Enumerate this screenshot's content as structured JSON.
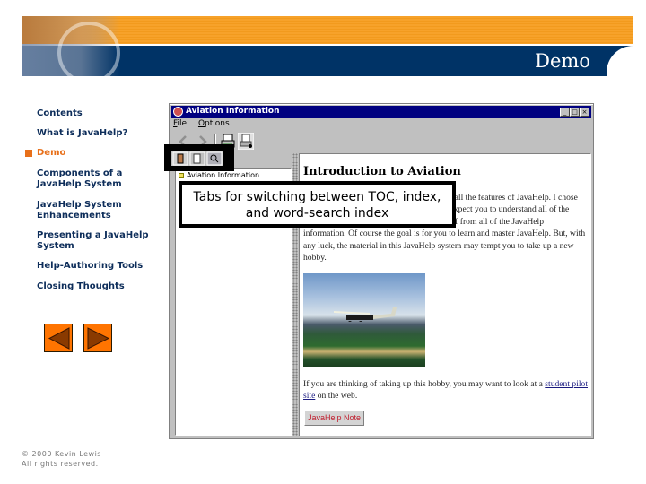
{
  "banner": {
    "title": "Demo",
    "colors": {
      "orange": "#f7a22a",
      "navy": "#003366"
    }
  },
  "nav": {
    "items": [
      {
        "label": "Contents",
        "active": false
      },
      {
        "label": "What is JavaHelp?",
        "active": false
      },
      {
        "label": "Demo",
        "active": true
      },
      {
        "label": "Components of a JavaHelp System",
        "active": false
      },
      {
        "label": "JavaHelp System Enhancements",
        "active": false
      },
      {
        "label": "Presenting a JavaHelp System",
        "active": false
      },
      {
        "label": "Help-Authoring Tools",
        "active": false
      },
      {
        "label": "Closing Thoughts",
        "active": false
      }
    ],
    "prev_icon": "left-triangle-icon",
    "next_icon": "right-triangle-icon",
    "active_color": "#e8701a"
  },
  "footer": {
    "line1": "© 2000 Kevin Lewis",
    "line2": "All rights reserved."
  },
  "window": {
    "title": "Aviation Information",
    "controls": {
      "minimize": "_",
      "maximize": "□",
      "close": "×"
    },
    "menu": [
      {
        "key": "F",
        "rest": "ile"
      },
      {
        "key": "O",
        "rest": "ptions"
      }
    ],
    "toolbar": [
      "back-icon",
      "forward-icon",
      "print-icon",
      "page-setup-icon"
    ],
    "tabs": [
      "toc-tab",
      "index-tab",
      "search-tab"
    ],
    "toc": [
      {
        "label": "Aviation Information",
        "icon": "book"
      },
      {
        "label": "",
        "icon": "topic"
      },
      {
        "label": "",
        "icon": "topic"
      },
      {
        "label": "",
        "icon": "topic"
      }
    ],
    "content": {
      "title": "Introduction to Aviation",
      "paragraph1": "This is a help system designed to show you all the features of JavaHelp. I chose this topic because it is simple and I do not expect you to understand all of the aviation topics, but I hope it provides a relief from all of the JavaHelp information. Of course the goal is for you to learn and master JavaHelp. But, with any luck, the material in this JavaHelp system may tempt you to take up a new hobby.",
      "paragraph2_pre": "If you are thinking of taking up this hobby, you may want to look at a ",
      "paragraph2_link": "student pilot site",
      "paragraph2_post": " on the web.",
      "button": "JavaHelp Note"
    }
  },
  "callout": {
    "text": "Tabs for switching between TOC, index, and word-search index"
  }
}
